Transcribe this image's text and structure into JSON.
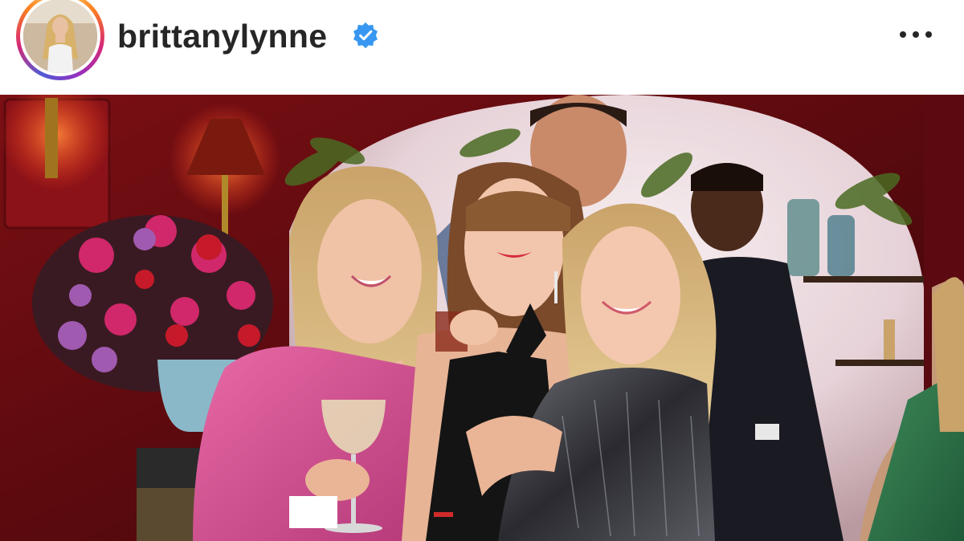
{
  "post": {
    "author": {
      "username": "brittanylynne",
      "verified": true,
      "avatar_icon": "profile-photo",
      "story_ring_colors": [
        "#feda75",
        "#fa7e1e",
        "#d62976",
        "#962fbf",
        "#4f5bd5"
      ]
    },
    "more_options_icon": "more-horizontal-icon",
    "verified_badge_color": "#3897f0",
    "media": {
      "type": "photo",
      "description_icon": "party-photo"
    }
  }
}
